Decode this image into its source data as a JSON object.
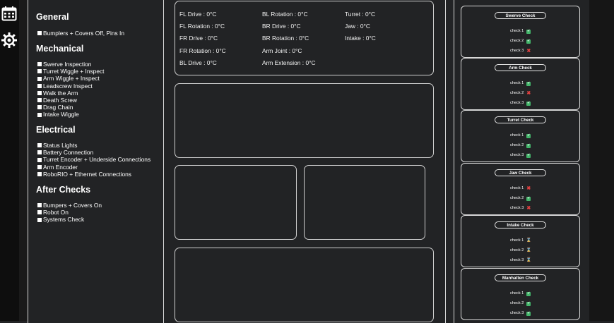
{
  "nav": {
    "icons": [
      "calendar-icon",
      "gear-icon"
    ]
  },
  "checklist": {
    "sections": [
      {
        "title": "General",
        "items": [
          "Bumplers + Covers Off, Pins In"
        ]
      },
      {
        "title": "Mechanical",
        "items": [
          "Swerve Inspection",
          "Turret Wiggle + Inspect",
          "Arm Wiggle + Inspect",
          "Leadscrew Inspect",
          "Walk the Arm",
          "Death Screw",
          "Drag Chain",
          "Intake Wiggle"
        ]
      },
      {
        "title": "Electrical",
        "items": [
          "Status Lights",
          "Battery Connection",
          "Turret Encoder + Underside Connections",
          "Arm Encoder",
          "RoboRIO + Ethernet Connections"
        ]
      },
      {
        "title": "After Checks",
        "items": [
          "Bumpers + Covers On",
          "Robot On",
          "Systems Check"
        ]
      }
    ]
  },
  "sensors": {
    "col1": [
      "FL Drive : 0°C",
      "FL Rotation : 0°C",
      "FR Drive : 0°C",
      "FR Rotation : 0°C",
      "BL Drive : 0°C"
    ],
    "col2": [
      "BL Rotation : 0°C",
      "BR Drive : 0°C",
      "BR Rotation : 0°C",
      "Arm Joint : 0°C",
      "Arm Extension : 0°C"
    ],
    "col3": [
      "Turret : 0°C",
      "Jaw : 0°C",
      "Intake : 0°C"
    ]
  },
  "checks": [
    {
      "title": "Swerve Check",
      "rows": [
        {
          "label": "check 1",
          "status": "pass"
        },
        {
          "label": "check 2",
          "status": "pass"
        },
        {
          "label": "check 3",
          "status": "fail"
        }
      ]
    },
    {
      "title": "Arm Check",
      "rows": [
        {
          "label": "check 1",
          "status": "pass"
        },
        {
          "label": "check 2",
          "status": "fail"
        },
        {
          "label": "check 3",
          "status": "pass"
        }
      ]
    },
    {
      "title": "Turret Check",
      "rows": [
        {
          "label": "check 1",
          "status": "pass"
        },
        {
          "label": "check 2",
          "status": "pass"
        },
        {
          "label": "check 3",
          "status": "pass"
        }
      ]
    },
    {
      "title": "Jaw Check",
      "rows": [
        {
          "label": "check 1",
          "status": "fail"
        },
        {
          "label": "check 2",
          "status": "pass"
        },
        {
          "label": "check 3",
          "status": "fail"
        }
      ]
    },
    {
      "title": "Intake Check",
      "rows": [
        {
          "label": "check 1",
          "status": "pending"
        },
        {
          "label": "check 2",
          "status": "pending"
        },
        {
          "label": "check 3",
          "status": "pending"
        }
      ]
    },
    {
      "title": "Manhatten Check",
      "rows": [
        {
          "label": "check 1",
          "status": "pass"
        },
        {
          "label": "check 2",
          "status": "pass"
        },
        {
          "label": "check 3",
          "status": "pass"
        }
      ]
    }
  ],
  "colors": {
    "pass": "#43b56a",
    "fail": "#e04040",
    "pending": "#d9a24a",
    "background": "#222325"
  }
}
